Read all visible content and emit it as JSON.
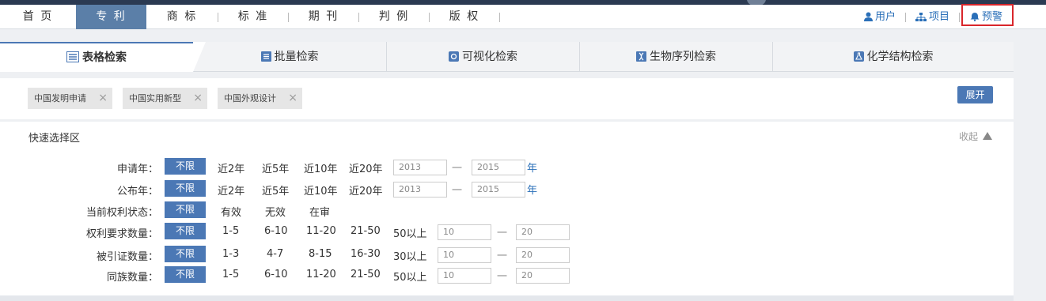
{
  "nav": {
    "items": [
      "首 页",
      "专 利",
      "商 标",
      "标 准",
      "期 刊",
      "判 例",
      "版 权"
    ],
    "active": "专 利"
  },
  "user_links": {
    "user": "用户",
    "project": "项目",
    "alert": "预警"
  },
  "tabs": [
    "表格检索",
    "批量检索",
    "可视化检索",
    "生物序列检索",
    "化学结构检索"
  ],
  "chips": [
    "中国发明申请",
    "中国实用新型",
    "中国外观设计"
  ],
  "chip_close": "×",
  "expand_label": "展开",
  "quick": {
    "title": "快速选择区",
    "collapse": "收起",
    "unlimited": "不限",
    "dash": "一",
    "rows": [
      {
        "label": "申请年：",
        "options": [
          "近2年",
          "近5年",
          "近10年",
          "近20年"
        ],
        "from": "2013",
        "to": "2015",
        "unit": "年"
      },
      {
        "label": "公布年：",
        "options": [
          "近2年",
          "近5年",
          "近10年",
          "近20年"
        ],
        "from": "2013",
        "to": "2015",
        "unit": "年"
      },
      {
        "label": "当前权利状态：",
        "options": [
          "有效",
          "无效",
          "在审"
        ]
      },
      {
        "label": "权利要求数量：",
        "options": [
          "1-5",
          "6-10",
          "11-20",
          "21-50",
          "50以上"
        ],
        "from": "10",
        "to": "20"
      },
      {
        "label": "被引证数量：",
        "options": [
          "1-3",
          "4-7",
          "8-15",
          "16-30",
          "30以上"
        ],
        "from": "10",
        "to": "20"
      },
      {
        "label": "同族数量：",
        "options": [
          "1-5",
          "6-10",
          "11-20",
          "21-50",
          "50以上"
        ],
        "from": "10",
        "to": "20"
      }
    ]
  },
  "colors": {
    "accent": "#4b78b5",
    "nav_active": "#5b7fa8",
    "link": "#2a6fb8",
    "highlight_border": "#d9262b"
  }
}
